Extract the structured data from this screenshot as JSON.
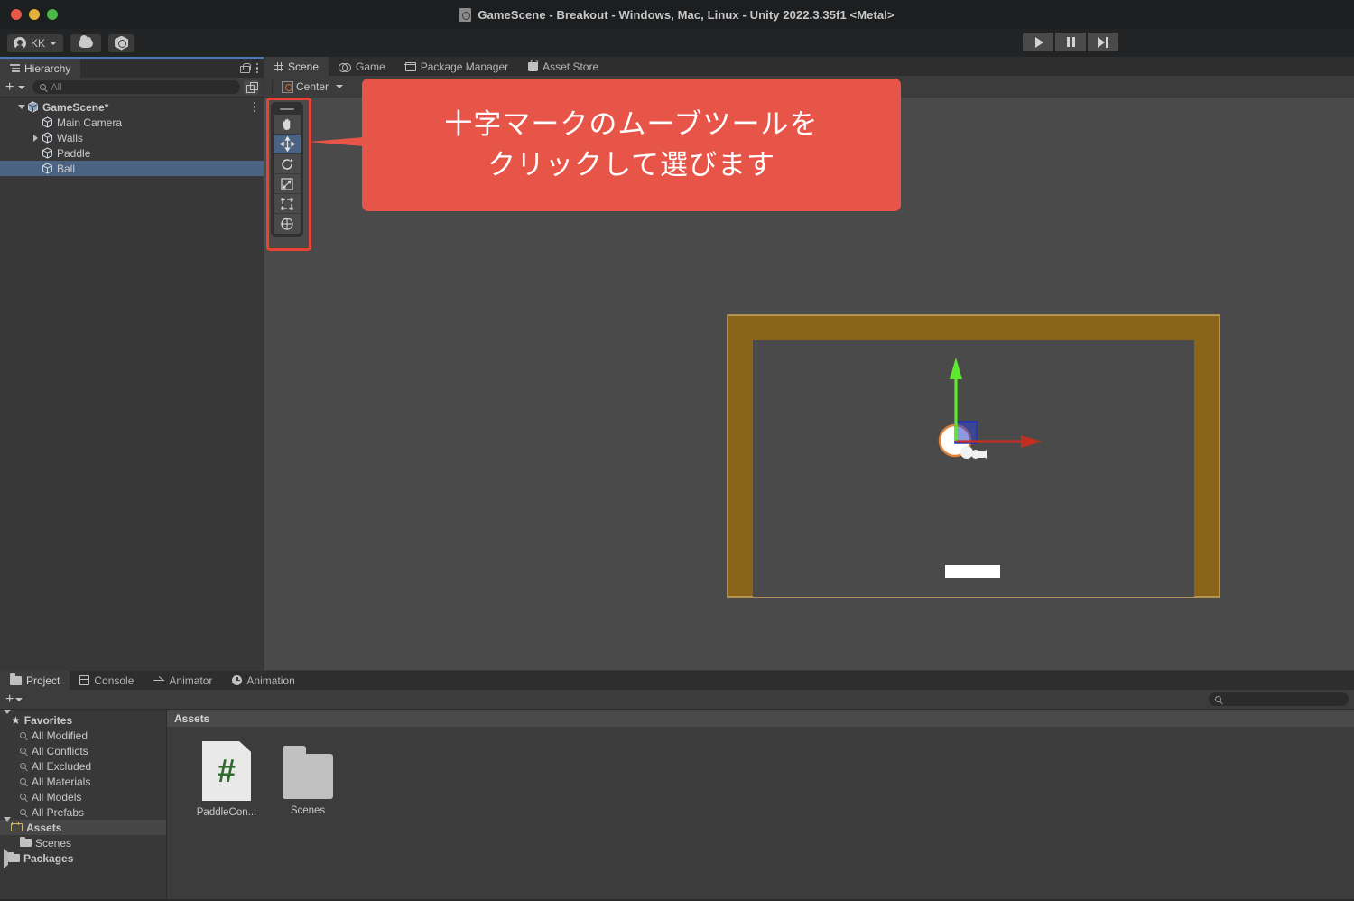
{
  "window": {
    "title": "GameScene - Breakout - Windows, Mac, Linux - Unity 2022.3.35f1 <Metal>",
    "traffic_lights": [
      "close",
      "minimize",
      "zoom"
    ]
  },
  "top_toolbar": {
    "account_label": "KK",
    "account_icon": "person-icon",
    "cloud_icon": "cloud-icon",
    "services_icon": "unity-services-icon",
    "play_icon": "play-icon",
    "pause_icon": "pause-icon",
    "step_icon": "step-icon"
  },
  "hierarchy": {
    "tab_label": "Hierarchy",
    "tab_icon": "hierarchy-icon",
    "lock_icon": "lock-icon",
    "menu_icon": "kebab-menu-icon",
    "add_label": "+",
    "search_placeholder": "All",
    "search_value": "",
    "search_icon": "search-icon",
    "persist_icon": "persist-icon",
    "tree": [
      {
        "label": "GameScene*",
        "depth": 0,
        "expanded": true,
        "selected": false,
        "icon": "scene-cube-icon",
        "has_menu": true
      },
      {
        "label": "Main Camera",
        "depth": 1,
        "expanded": null,
        "selected": false,
        "icon": "gameobject-cube-icon",
        "has_menu": false
      },
      {
        "label": "Walls",
        "depth": 1,
        "expanded": false,
        "selected": false,
        "icon": "gameobject-cube-icon",
        "has_menu": false
      },
      {
        "label": "Paddle",
        "depth": 1,
        "expanded": null,
        "selected": false,
        "icon": "gameobject-cube-icon",
        "has_menu": false
      },
      {
        "label": "Ball",
        "depth": 1,
        "expanded": null,
        "selected": true,
        "icon": "gameobject-cube-icon",
        "has_menu": false
      }
    ]
  },
  "scene_panel": {
    "tabs": [
      {
        "label": "Scene",
        "icon": "grid-icon",
        "active": true
      },
      {
        "label": "Game",
        "icon": "game-controller-icon",
        "active": false
      },
      {
        "label": "Package Manager",
        "icon": "package-icon",
        "active": false
      },
      {
        "label": "Asset Store",
        "icon": "store-bag-icon",
        "active": false
      }
    ],
    "pivot_label": "Center",
    "pivot_icon": "pivot-center-icon",
    "tools": [
      {
        "name": "hand-tool",
        "icon": "hand-icon",
        "active": false
      },
      {
        "name": "move-tool",
        "icon": "move-cross-icon",
        "active": true
      },
      {
        "name": "rotate-tool",
        "icon": "rotate-icon",
        "active": false
      },
      {
        "name": "scale-tool",
        "icon": "scale-icon",
        "active": false
      },
      {
        "name": "rect-tool",
        "icon": "rect-icon",
        "active": false
      },
      {
        "name": "transform-tool",
        "icon": "transform-icon",
        "active": false
      }
    ]
  },
  "callout": {
    "line1": "十字マークのムーブツールを",
    "line2": "クリックして選びます",
    "bg_color": "#e75549",
    "text_color": "#ffffff",
    "highlight_color": "#ea4335"
  },
  "scene_objects": {
    "walls_color": "#8a6418",
    "field_color": "#4a4a4a",
    "paddle_color": "#ffffff",
    "ball_color": "#ffffff",
    "ball_outline_color": "#e0833a",
    "gizmo_y_color": "#60e830",
    "gizmo_x_color": "#c03020",
    "gizmo_z_color": "#2030c0"
  },
  "project_panel": {
    "tabs": [
      {
        "label": "Project",
        "icon": "folder-icon",
        "active": true
      },
      {
        "label": "Console",
        "icon": "console-icon",
        "active": false
      },
      {
        "label": "Animator",
        "icon": "animator-icon",
        "active": false
      },
      {
        "label": "Animation",
        "icon": "animation-clock-icon",
        "active": false
      }
    ],
    "add_label": "+",
    "search_value": "",
    "search_icon": "search-icon",
    "tree": [
      {
        "label": "Favorites",
        "depth": 0,
        "expanded": true,
        "icon": "star-icon",
        "highlight": false
      },
      {
        "label": "All Modified",
        "depth": 1,
        "expanded": null,
        "icon": "search-icon",
        "highlight": false
      },
      {
        "label": "All Conflicts",
        "depth": 1,
        "expanded": null,
        "icon": "search-icon",
        "highlight": false
      },
      {
        "label": "All Excluded",
        "depth": 1,
        "expanded": null,
        "icon": "search-icon",
        "highlight": false
      },
      {
        "label": "All Materials",
        "depth": 1,
        "expanded": null,
        "icon": "search-icon",
        "highlight": false
      },
      {
        "label": "All Models",
        "depth": 1,
        "expanded": null,
        "icon": "search-icon",
        "highlight": false
      },
      {
        "label": "All Prefabs",
        "depth": 1,
        "expanded": null,
        "icon": "search-icon",
        "highlight": false
      },
      {
        "label": "Assets",
        "depth": 0,
        "expanded": true,
        "icon": "folder-open-icon",
        "highlight": true
      },
      {
        "label": "Scenes",
        "depth": 1,
        "expanded": null,
        "icon": "folder-icon",
        "highlight": false
      },
      {
        "label": "Packages",
        "depth": 0,
        "expanded": false,
        "icon": "folder-icon",
        "highlight": false
      }
    ],
    "breadcrumb": "Assets",
    "assets": [
      {
        "label": "PaddleCon...",
        "type": "csharp-script",
        "glyph": "#"
      },
      {
        "label": "Scenes",
        "type": "folder",
        "glyph": ""
      }
    ]
  }
}
